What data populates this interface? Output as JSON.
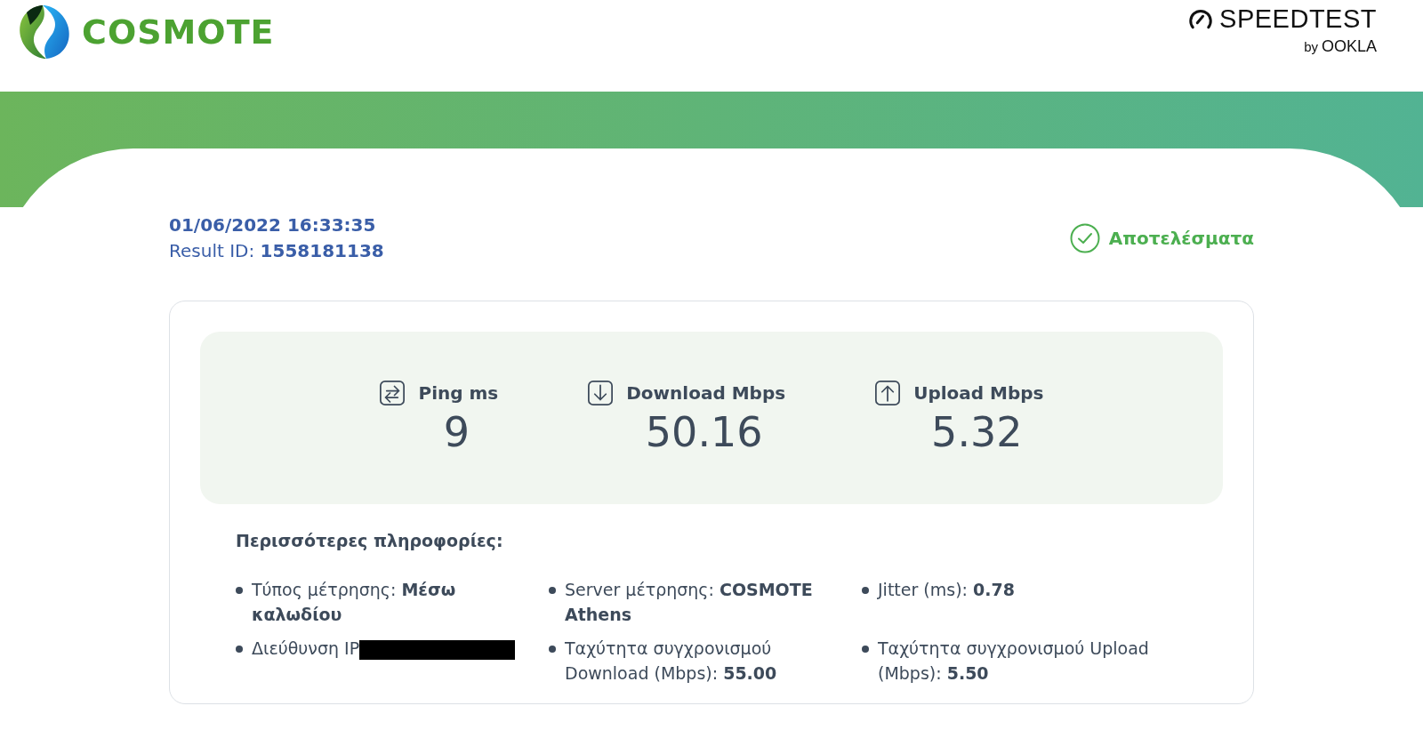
{
  "header": {
    "brand": "COSMOTE",
    "partner": {
      "name": "SPEEDTEST",
      "by": "by",
      "company": "OOKLA"
    }
  },
  "result": {
    "datetime": "01/06/2022 16:33:35",
    "id_label": "Result ID:",
    "id_value": "1558181138",
    "status": "Αποτελέσματα"
  },
  "metrics": [
    {
      "kind": "ping",
      "label": "Ping ms",
      "value": "9"
    },
    {
      "kind": "download",
      "label": "Download Mbps",
      "value": "50.16"
    },
    {
      "kind": "upload",
      "label": "Upload Mbps",
      "value": "5.32"
    }
  ],
  "details": {
    "title": "Περισσότερες πληροφορίες:",
    "items": [
      {
        "text": "Τύπος μέτρησης: **Μέσω καλωδίου**",
        "redacted": false
      },
      {
        "text": "Server μέτρησης: **COSMOTE Athens**",
        "redacted": false
      },
      {
        "text": "Jitter (ms): **0.78**",
        "redacted": false
      },
      {
        "text": "Διεύθυνση IP",
        "redacted": true
      },
      {
        "text": "Ταχύτητα συγχρονισμού Download (Mbps): **55.00**",
        "redacted": false
      },
      {
        "text": "Ταχύτητα συγχρονισμού Upload (Mbps): **5.50**",
        "redacted": false
      }
    ]
  }
}
